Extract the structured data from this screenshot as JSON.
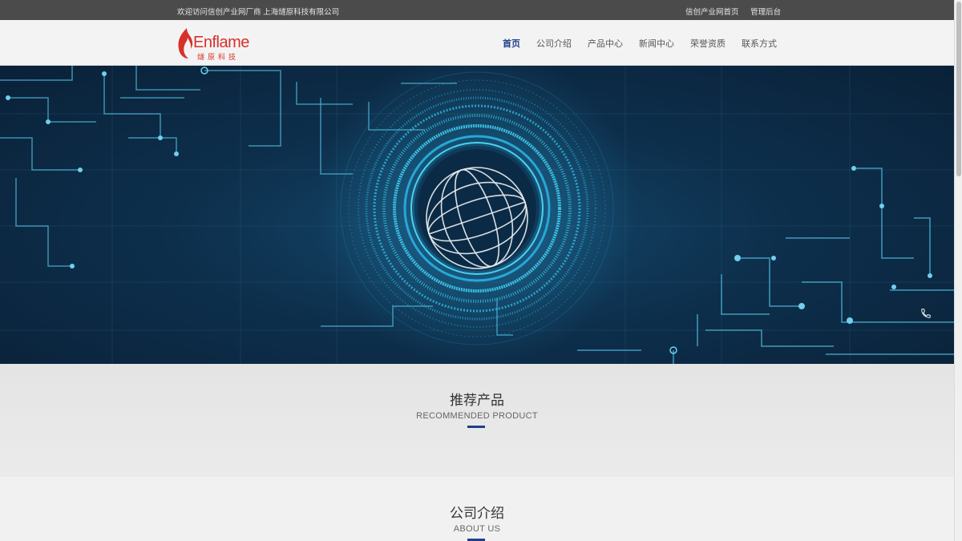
{
  "topbar": {
    "welcome": "欢迎访问信创产业网厂商 上海燧原科技有限公司",
    "links": [
      "信创产业网首页",
      "管理后台"
    ]
  },
  "logo": {
    "brand": "Enflame",
    "brand_cn": "燧原科技",
    "accent_color": "#d8312a"
  },
  "nav": {
    "items": [
      "首页",
      "公司介绍",
      "产品中心",
      "新闻中心",
      "荣誉资质",
      "联系方式"
    ],
    "active_index": 0,
    "active_color": "#1f3f8a"
  },
  "banner": {
    "phone_icon": "phone-icon"
  },
  "sections": {
    "products": {
      "title": "推荐产品",
      "subtitle": "RECOMMENDED PRODUCT"
    },
    "about": {
      "title": "公司介绍",
      "subtitle": "ABOUT US"
    }
  }
}
